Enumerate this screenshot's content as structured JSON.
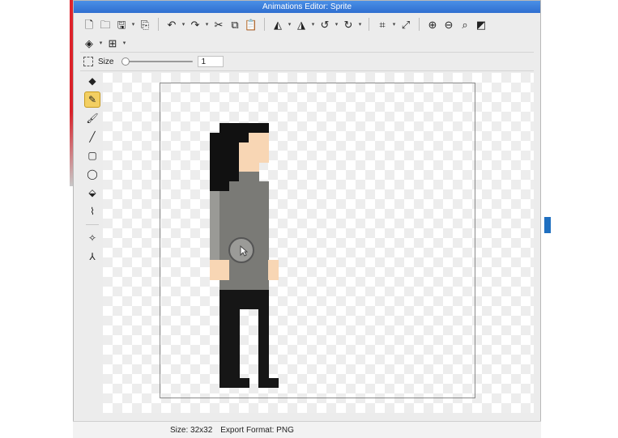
{
  "window": {
    "title": "Animations Editor: Sprite"
  },
  "toolbar": {
    "row1": [
      {
        "name": "new-file-icon",
        "glyph": "🗋"
      },
      {
        "name": "open-folder-icon",
        "glyph": "🗀"
      },
      {
        "name": "save-icon",
        "glyph": "🖫",
        "caret": true
      },
      {
        "name": "export-icon",
        "glyph": "⎘"
      },
      {
        "sep": true
      },
      {
        "name": "undo-icon",
        "glyph": "↶",
        "caret": true
      },
      {
        "name": "redo-icon",
        "glyph": "↷",
        "caret": true
      },
      {
        "name": "cut-icon",
        "glyph": "✂"
      },
      {
        "name": "copy-icon",
        "glyph": "⧉"
      },
      {
        "name": "paste-icon",
        "glyph": "📋"
      },
      {
        "sep": true
      },
      {
        "name": "flip-horizontal-icon",
        "glyph": "◭",
        "caret": true
      },
      {
        "name": "flip-vertical-icon",
        "glyph": "◮",
        "caret": true
      },
      {
        "name": "rotate-left-icon",
        "glyph": "↺",
        "caret": true
      },
      {
        "name": "rotate-right-icon",
        "glyph": "↻",
        "caret": true
      },
      {
        "sep": true
      },
      {
        "name": "crop-icon",
        "glyph": "⌗",
        "caret": true
      },
      {
        "name": "resize-icon",
        "glyph": "⤢"
      },
      {
        "sep": true
      },
      {
        "name": "zoom-in-icon",
        "glyph": "⊕"
      },
      {
        "name": "zoom-out-icon",
        "glyph": "⊖"
      },
      {
        "name": "zoom-fit-icon",
        "glyph": "⌕"
      },
      {
        "name": "background-toggle-icon",
        "glyph": "◩"
      }
    ],
    "row2": [
      {
        "name": "layers-icon",
        "glyph": "◈",
        "caret": true
      },
      {
        "name": "grid-icon",
        "glyph": "⊞",
        "caret": true
      }
    ]
  },
  "options": {
    "size_label": "Size",
    "size_value": "1",
    "slider_fraction": 0.0
  },
  "tools": [
    {
      "name": "eraser-tool",
      "glyph": "◆",
      "active": false
    },
    {
      "name": "pencil-tool",
      "glyph": "✎",
      "active": true
    },
    {
      "name": "brush-tool",
      "glyph": "🖌",
      "active": false
    },
    {
      "name": "line-tool",
      "glyph": "╱",
      "active": false
    },
    {
      "name": "rectangle-tool",
      "glyph": "▢",
      "active": false
    },
    {
      "name": "ellipse-tool",
      "glyph": "◯",
      "active": false
    },
    {
      "name": "fill-tool",
      "glyph": "⬙",
      "active": false
    },
    {
      "name": "eyedropper-tool",
      "glyph": "⌇",
      "active": false
    },
    {
      "sep": true
    },
    {
      "name": "sparkle-tool",
      "glyph": "✧",
      "active": false
    },
    {
      "name": "node-tool",
      "glyph": "⅄",
      "active": false
    }
  ],
  "sprite": {
    "grid": 32,
    "colors": {
      "hair": "#111111",
      "skin": "#f8d6b4",
      "shirt": "#7a7a76",
      "shirt_light": "#9a9a96",
      "pants": "#161616"
    },
    "pixels": [
      [
        6,
        4,
        "hair"
      ],
      [
        7,
        4,
        "hair"
      ],
      [
        8,
        4,
        "hair"
      ],
      [
        9,
        4,
        "hair"
      ],
      [
        10,
        4,
        "hair"
      ],
      [
        5,
        5,
        "hair"
      ],
      [
        6,
        5,
        "hair"
      ],
      [
        7,
        5,
        "hair"
      ],
      [
        8,
        5,
        "hair"
      ],
      [
        9,
        5,
        "skin"
      ],
      [
        10,
        5,
        "skin"
      ],
      [
        5,
        6,
        "hair"
      ],
      [
        6,
        6,
        "hair"
      ],
      [
        7,
        6,
        "hair"
      ],
      [
        8,
        6,
        "skin"
      ],
      [
        9,
        6,
        "skin"
      ],
      [
        10,
        6,
        "skin"
      ],
      [
        5,
        7,
        "hair"
      ],
      [
        6,
        7,
        "hair"
      ],
      [
        7,
        7,
        "hair"
      ],
      [
        8,
        7,
        "skin"
      ],
      [
        9,
        7,
        "skin"
      ],
      [
        10,
        7,
        "skin"
      ],
      [
        5,
        8,
        "hair"
      ],
      [
        6,
        8,
        "hair"
      ],
      [
        7,
        8,
        "hair"
      ],
      [
        8,
        8,
        "skin"
      ],
      [
        9,
        8,
        "skin"
      ],
      [
        5,
        9,
        "hair"
      ],
      [
        6,
        9,
        "hair"
      ],
      [
        7,
        9,
        "hair"
      ],
      [
        8,
        9,
        "shirt"
      ],
      [
        9,
        9,
        "shirt"
      ],
      [
        5,
        10,
        "hair"
      ],
      [
        6,
        10,
        "hair"
      ],
      [
        7,
        10,
        "shirt"
      ],
      [
        8,
        10,
        "shirt"
      ],
      [
        9,
        10,
        "shirt"
      ],
      [
        10,
        10,
        "shirt"
      ],
      [
        5,
        11,
        "shirt_light"
      ],
      [
        6,
        11,
        "shirt"
      ],
      [
        7,
        11,
        "shirt"
      ],
      [
        8,
        11,
        "shirt"
      ],
      [
        9,
        11,
        "shirt"
      ],
      [
        10,
        11,
        "shirt"
      ],
      [
        5,
        12,
        "shirt_light"
      ],
      [
        6,
        12,
        "shirt"
      ],
      [
        7,
        12,
        "shirt"
      ],
      [
        8,
        12,
        "shirt"
      ],
      [
        9,
        12,
        "shirt"
      ],
      [
        10,
        12,
        "shirt"
      ],
      [
        5,
        13,
        "shirt_light"
      ],
      [
        6,
        13,
        "shirt"
      ],
      [
        7,
        13,
        "shirt"
      ],
      [
        8,
        13,
        "shirt"
      ],
      [
        9,
        13,
        "shirt"
      ],
      [
        10,
        13,
        "shirt"
      ],
      [
        5,
        14,
        "shirt_light"
      ],
      [
        6,
        14,
        "shirt"
      ],
      [
        7,
        14,
        "shirt"
      ],
      [
        8,
        14,
        "shirt"
      ],
      [
        9,
        14,
        "shirt"
      ],
      [
        10,
        14,
        "shirt"
      ],
      [
        5,
        15,
        "shirt_light"
      ],
      [
        6,
        15,
        "shirt"
      ],
      [
        7,
        15,
        "shirt"
      ],
      [
        8,
        15,
        "shirt"
      ],
      [
        9,
        15,
        "shirt"
      ],
      [
        10,
        15,
        "shirt"
      ],
      [
        5,
        16,
        "shirt_light"
      ],
      [
        6,
        16,
        "shirt"
      ],
      [
        7,
        16,
        "shirt"
      ],
      [
        8,
        16,
        "shirt"
      ],
      [
        9,
        16,
        "shirt"
      ],
      [
        10,
        16,
        "shirt"
      ],
      [
        5,
        17,
        "shirt_light"
      ],
      [
        6,
        17,
        "shirt"
      ],
      [
        7,
        17,
        "shirt"
      ],
      [
        8,
        17,
        "shirt"
      ],
      [
        9,
        17,
        "shirt"
      ],
      [
        10,
        17,
        "shirt"
      ],
      [
        5,
        18,
        "skin"
      ],
      [
        6,
        18,
        "skin"
      ],
      [
        7,
        18,
        "shirt"
      ],
      [
        8,
        18,
        "shirt"
      ],
      [
        9,
        18,
        "shirt"
      ],
      [
        10,
        18,
        "shirt"
      ],
      [
        11,
        18,
        "skin"
      ],
      [
        5,
        19,
        "skin"
      ],
      [
        6,
        19,
        "skin"
      ],
      [
        7,
        19,
        "shirt"
      ],
      [
        8,
        19,
        "shirt"
      ],
      [
        9,
        19,
        "shirt"
      ],
      [
        10,
        19,
        "shirt"
      ],
      [
        11,
        19,
        "skin"
      ],
      [
        6,
        20,
        "shirt"
      ],
      [
        7,
        20,
        "shirt"
      ],
      [
        8,
        20,
        "shirt"
      ],
      [
        9,
        20,
        "shirt"
      ],
      [
        10,
        20,
        "shirt"
      ],
      [
        6,
        21,
        "pants"
      ],
      [
        7,
        21,
        "pants"
      ],
      [
        8,
        21,
        "pants"
      ],
      [
        9,
        21,
        "pants"
      ],
      [
        10,
        21,
        "pants"
      ],
      [
        6,
        22,
        "pants"
      ],
      [
        7,
        22,
        "pants"
      ],
      [
        8,
        22,
        "pants"
      ],
      [
        9,
        22,
        "pants"
      ],
      [
        10,
        22,
        "pants"
      ],
      [
        6,
        23,
        "pants"
      ],
      [
        7,
        23,
        "pants"
      ],
      [
        10,
        23,
        "pants"
      ],
      [
        6,
        24,
        "pants"
      ],
      [
        7,
        24,
        "pants"
      ],
      [
        10,
        24,
        "pants"
      ],
      [
        6,
        25,
        "pants"
      ],
      [
        7,
        25,
        "pants"
      ],
      [
        10,
        25,
        "pants"
      ],
      [
        6,
        26,
        "pants"
      ],
      [
        7,
        26,
        "pants"
      ],
      [
        10,
        26,
        "pants"
      ],
      [
        6,
        27,
        "pants"
      ],
      [
        7,
        27,
        "pants"
      ],
      [
        10,
        27,
        "pants"
      ],
      [
        6,
        28,
        "pants"
      ],
      [
        7,
        28,
        "pants"
      ],
      [
        10,
        28,
        "pants"
      ],
      [
        6,
        29,
        "pants"
      ],
      [
        7,
        29,
        "pants"
      ],
      [
        10,
        29,
        "pants"
      ],
      [
        6,
        30,
        "pants"
      ],
      [
        7,
        30,
        "pants"
      ],
      [
        8,
        30,
        "pants"
      ],
      [
        10,
        30,
        "pants"
      ],
      [
        11,
        30,
        "pants"
      ]
    ]
  },
  "status": {
    "size_text": "Size: 32x32",
    "format_text": "Export Format: PNG"
  }
}
